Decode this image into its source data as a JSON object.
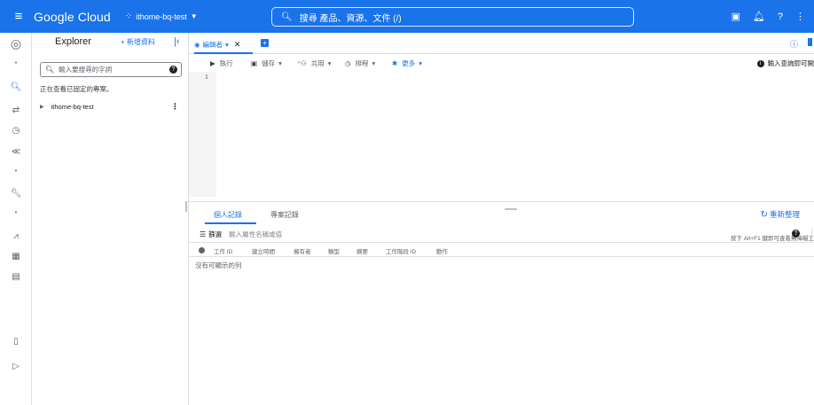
{
  "topbar": {
    "menu_icon": "hamburger-icon",
    "brand": "Google Cloud",
    "project_name": "ithome-bq-test",
    "search_placeholder": "搜尋  產品、資源、文件 (/)",
    "icons": [
      "cloud-shell-icon",
      "notifications-icon",
      "help-icon",
      "more-vert-icon"
    ],
    "color": "#1a73e8"
  },
  "rail": {
    "items": [
      "bigquery-logo-icon",
      "dot-icon",
      "search-icon",
      "transfers-icon",
      "history-icon",
      "connections-icon",
      "dot-icon",
      "wrench-icon",
      "dot-icon",
      "analytics-icon",
      "dashboard-icon",
      "table-icon",
      "release-notes-icon",
      "expand-icon"
    ]
  },
  "explorer": {
    "title": "Explorer",
    "add_label": "+ 新增資料",
    "collapse_icon": "collapse-icon",
    "search_placeholder": "輸入要搜尋的字詞",
    "note": "正在查看已固定的專案。",
    "project": "ithome-bq-test"
  },
  "editor": {
    "tab_label": "編輯者",
    "tab_chevron": "▾",
    "toolbar": {
      "run": "執行",
      "save": "儲存",
      "share": "共用",
      "schedule": "排程",
      "more": "更多"
    },
    "hint": "輸入查詢即可開",
    "line_number": "1",
    "shortcut_hint": "按下 Alt+F1 鍵即可查看無障礙工"
  },
  "results": {
    "tabs": [
      "個人記錄",
      "專案記錄"
    ],
    "refresh": "重新整理",
    "filter_label": "篩選",
    "filter_placeholder": "輸入屬性名稱或值",
    "columns": [
      "工作 ID",
      "建立時間",
      "擁有者",
      "類型",
      "摘要",
      "工作階段 ID",
      "動作"
    ],
    "empty_message": "沒有可顯示的列"
  }
}
